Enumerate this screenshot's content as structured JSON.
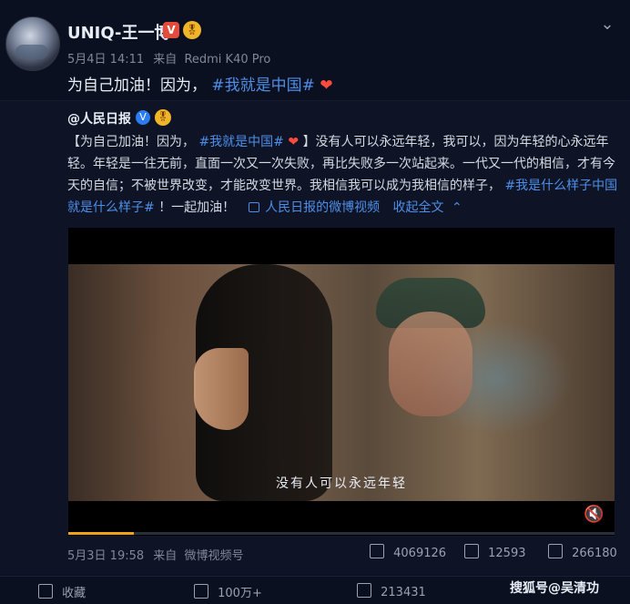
{
  "post": {
    "author_name": "UNIQ-王一博",
    "verified_badge": "V",
    "medal_badge": "🎖",
    "timestamp": "5月4日 14:11",
    "source_prefix": "来自",
    "source": "Redmi K40 Pro",
    "text_prefix": "为自己加油！因为，",
    "hashtag": "#我就是中国#",
    "heart": "❤",
    "collapse_icon": "chevron-down-icon"
  },
  "quoted": {
    "author_mention": "@人民日报",
    "verified_badge": "V",
    "medal_badge": "🎖",
    "text_part1": "【为自己加油！因为，",
    "hashtag1": "#我就是中国#",
    "heart": "❤",
    "text_part2": "】没有人可以永远年轻，我可以，因为年轻的心永远年轻。年轻是一往无前，直面一次又一次失败，再比失败多一次站起来。一代又一代的相信，才有今天的自信；不被世界改变，才能改变世界。我相信我可以成为我相信的样子，",
    "hashtag2": "#我是什么样子中国就是什么样子#",
    "text_part3": "！一起加油！",
    "video_link": "人民日报的微博视频",
    "collapse_label": "收起全文",
    "collapse_arrow": "⌃"
  },
  "video": {
    "subtitle": "没有人可以永远年轻",
    "mute_icon": "mute-icon",
    "progress": 0.12
  },
  "video_meta": {
    "date": "5月3日 19:58",
    "source_prefix": "来自",
    "source": "微博视频号",
    "stats": [
      {
        "icon": "share-icon",
        "value": "4069126"
      },
      {
        "icon": "comment-icon",
        "value": "12593"
      },
      {
        "icon": "like-icon",
        "value": "266180"
      }
    ]
  },
  "actions": [
    {
      "icon": "favorite-icon",
      "label": "收藏"
    },
    {
      "icon": "share-icon",
      "label": "100万+"
    },
    {
      "icon": "comment-icon",
      "label": "213431"
    }
  ],
  "watermark": "搜狐号@吴清功",
  "colors": {
    "link_blue": "#4d8ee8",
    "heart_red": "#ff4b3e",
    "progress_orange": "#f0a21a",
    "background": "#0b1020"
  }
}
